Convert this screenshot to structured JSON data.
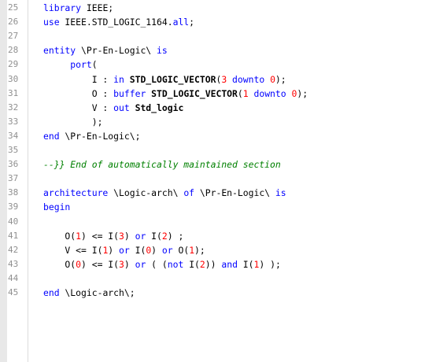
{
  "editor": {
    "colors": {
      "keyword": "#0000ff",
      "number": "#ff0000",
      "comment": "#008000",
      "text": "#000000",
      "line_number": "#909090",
      "gutter_strip": "#e8e8e8"
    },
    "lines": [
      {
        "n": "25",
        "tokens": [
          [
            "kw",
            "library"
          ],
          [
            "id",
            " IEEE;"
          ]
        ]
      },
      {
        "n": "26",
        "tokens": [
          [
            "kw",
            "use"
          ],
          [
            "id",
            " IEEE.STD_LOGIC_1164."
          ],
          [
            "kw",
            "all"
          ],
          [
            "id",
            ";"
          ]
        ]
      },
      {
        "n": "27",
        "tokens": []
      },
      {
        "n": "28",
        "tokens": [
          [
            "kw",
            "entity"
          ],
          [
            "id",
            " \\Pr-En-Logic\\ "
          ],
          [
            "kw",
            "is"
          ]
        ]
      },
      {
        "n": "29",
        "tokens": [
          [
            "id",
            "     "
          ],
          [
            "kw",
            "port"
          ],
          [
            "id",
            "("
          ]
        ]
      },
      {
        "n": "30",
        "tokens": [
          [
            "id",
            "         I : "
          ],
          [
            "kw",
            "in"
          ],
          [
            "id",
            " "
          ],
          [
            "typ",
            "STD_LOGIC_VECTOR"
          ],
          [
            "id",
            "("
          ],
          [
            "num",
            "3"
          ],
          [
            "id",
            " "
          ],
          [
            "kw",
            "downto"
          ],
          [
            "id",
            " "
          ],
          [
            "num",
            "0"
          ],
          [
            "id",
            ");"
          ]
        ]
      },
      {
        "n": "31",
        "tokens": [
          [
            "id",
            "         O : "
          ],
          [
            "kw",
            "buffer"
          ],
          [
            "id",
            " "
          ],
          [
            "typ",
            "STD_LOGIC_VECTOR"
          ],
          [
            "id",
            "("
          ],
          [
            "num",
            "1"
          ],
          [
            "id",
            " "
          ],
          [
            "kw",
            "downto"
          ],
          [
            "id",
            " "
          ],
          [
            "num",
            "0"
          ],
          [
            "id",
            ");"
          ]
        ]
      },
      {
        "n": "32",
        "tokens": [
          [
            "id",
            "         V : "
          ],
          [
            "kw",
            "out"
          ],
          [
            "id",
            " "
          ],
          [
            "typ",
            "Std_logic"
          ]
        ]
      },
      {
        "n": "33",
        "tokens": [
          [
            "id",
            "         );"
          ]
        ]
      },
      {
        "n": "34",
        "tokens": [
          [
            "kw",
            "end"
          ],
          [
            "id",
            " \\Pr-En-Logic\\;"
          ]
        ]
      },
      {
        "n": "35",
        "tokens": []
      },
      {
        "n": "36",
        "tokens": [
          [
            "cmt",
            "--}} End of automatically maintained section"
          ]
        ]
      },
      {
        "n": "37",
        "tokens": []
      },
      {
        "n": "38",
        "tokens": [
          [
            "kw",
            "architecture"
          ],
          [
            "id",
            " \\Logic-arch\\ "
          ],
          [
            "kw",
            "of"
          ],
          [
            "id",
            " \\Pr-En-Logic\\ "
          ],
          [
            "kw",
            "is"
          ]
        ]
      },
      {
        "n": "39",
        "tokens": [
          [
            "kw",
            "begin"
          ]
        ]
      },
      {
        "n": "40",
        "tokens": []
      },
      {
        "n": "41",
        "tokens": [
          [
            "id",
            "    O("
          ],
          [
            "num",
            "1"
          ],
          [
            "id",
            ") <= I("
          ],
          [
            "num",
            "3"
          ],
          [
            "id",
            ") "
          ],
          [
            "kw",
            "or"
          ],
          [
            "id",
            " I("
          ],
          [
            "num",
            "2"
          ],
          [
            "id",
            ") ;"
          ]
        ]
      },
      {
        "n": "42",
        "tokens": [
          [
            "id",
            "    V <= I("
          ],
          [
            "num",
            "1"
          ],
          [
            "id",
            ") "
          ],
          [
            "kw",
            "or"
          ],
          [
            "id",
            " I("
          ],
          [
            "num",
            "0"
          ],
          [
            "id",
            ") "
          ],
          [
            "kw",
            "or"
          ],
          [
            "id",
            " O("
          ],
          [
            "num",
            "1"
          ],
          [
            "id",
            ");"
          ]
        ]
      },
      {
        "n": "43",
        "tokens": [
          [
            "id",
            "    O("
          ],
          [
            "num",
            "0"
          ],
          [
            "id",
            ") <= I("
          ],
          [
            "num",
            "3"
          ],
          [
            "id",
            ") "
          ],
          [
            "kw",
            "or"
          ],
          [
            "id",
            " ( ("
          ],
          [
            "kw",
            "not"
          ],
          [
            "id",
            " I("
          ],
          [
            "num",
            "2"
          ],
          [
            "id",
            ")) "
          ],
          [
            "kw",
            "and"
          ],
          [
            "id",
            " I("
          ],
          [
            "num",
            "1"
          ],
          [
            "id",
            ") );"
          ]
        ]
      },
      {
        "n": "44",
        "tokens": []
      },
      {
        "n": "45",
        "tokens": [
          [
            "kw",
            "end"
          ],
          [
            "id",
            " \\Logic-arch\\;"
          ]
        ]
      }
    ]
  }
}
